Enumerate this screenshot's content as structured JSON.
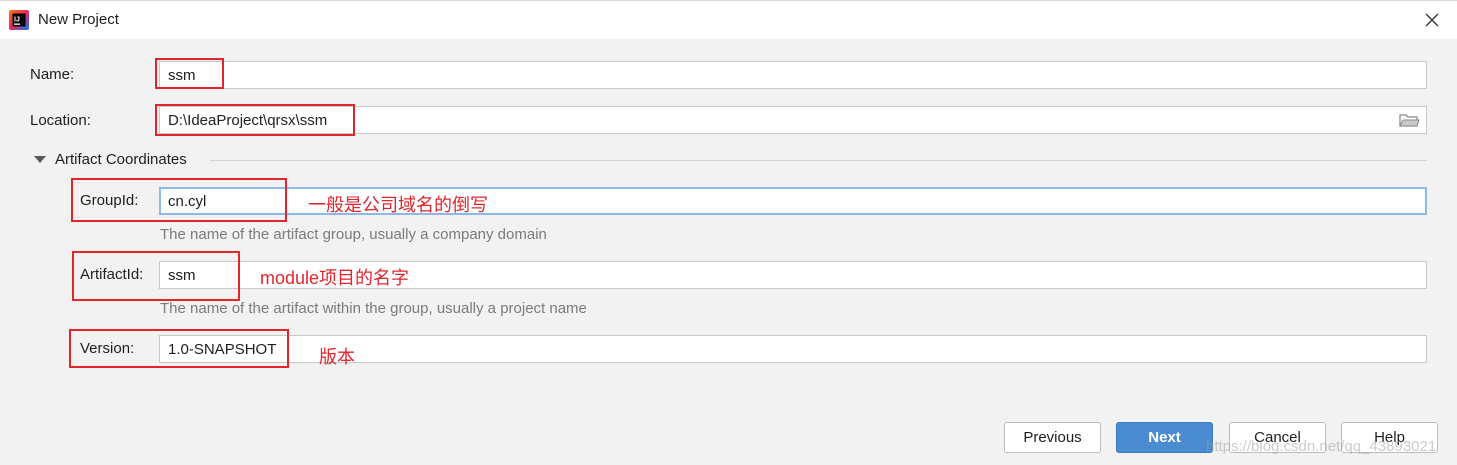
{
  "window": {
    "title": "New Project",
    "icons": {
      "app": "intellij-icon",
      "close": "close-icon"
    }
  },
  "form": {
    "name_label": "Name:",
    "name_value": "ssm",
    "location_label": "Location:",
    "location_value": "D:\\IdeaProject\\qrsx\\ssm",
    "location_browse_icon": "folder-icon",
    "section_title": "Artifact Coordinates",
    "group_label": "GroupId:",
    "group_value": "cn.cyl",
    "group_hint": "The name of the artifact group, usually a company domain",
    "artifact_label": "ArtifactId:",
    "artifact_value": "ssm",
    "artifact_hint": "The name of the artifact within the group, usually a project name",
    "version_label": "Version:",
    "version_value": "1.0-SNAPSHOT"
  },
  "annotations": {
    "group_note": "一般是公司域名的倒写",
    "artifact_note": "module项目的名字",
    "version_note": "版本"
  },
  "buttons": {
    "previous": "Previous",
    "next": "Next",
    "cancel": "Cancel",
    "help": "Help"
  },
  "watermark": "https://blog.csdn.net/qq_43893021",
  "colors": {
    "accent": "#4a8bd2",
    "annotation": "#e0262d",
    "focus_border": "#8fb8e6",
    "background": "#f2f2f2"
  }
}
